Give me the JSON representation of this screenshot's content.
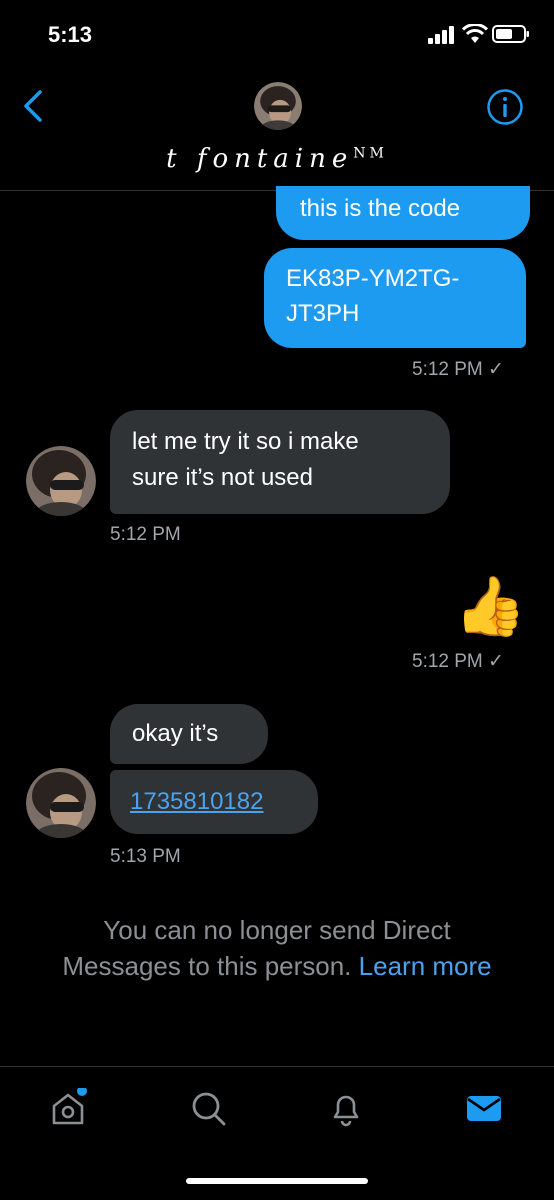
{
  "status": {
    "time": "5:13"
  },
  "header": {
    "contact_name": "t fontaine",
    "contact_suffix": "NM",
    "back_icon": "chevron-left-icon",
    "info_icon": "info-icon"
  },
  "messages": {
    "out1_text": "this is the code",
    "out2_line1": "EK83P-YM2TG-",
    "out2_line2": "JT3PH",
    "out2_time": "5:12 PM ✓",
    "in1_line1": "let me try it so i make",
    "in1_line2": "sure it’s not used",
    "in1_time": "5:12 PM",
    "out3_emoji": "👍",
    "out3_time": "5:12 PM ✓",
    "in2_text": "okay it’s",
    "in3_link": "1735810182",
    "in3_time": "5:13 PM"
  },
  "notice": {
    "line1": "You can no longer send Direct",
    "line2": "Messages to this person.",
    "learn_more": "Learn more"
  },
  "nav": {
    "items": [
      "home-icon",
      "search-icon",
      "notifications-icon",
      "messages-icon"
    ],
    "accent": "#1d9bf0"
  }
}
